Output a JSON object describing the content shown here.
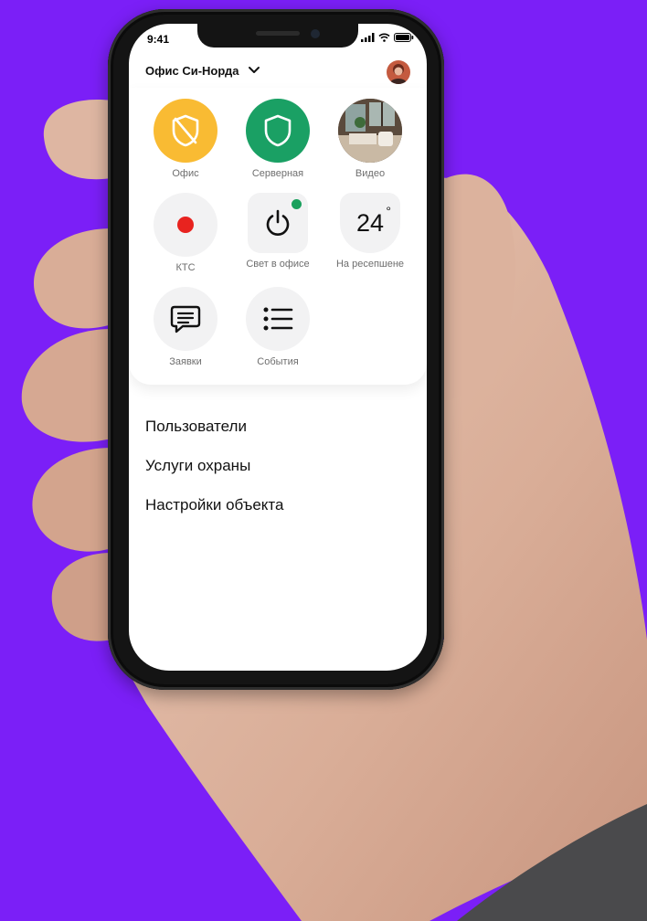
{
  "status_bar": {
    "time": "9:41"
  },
  "header": {
    "object_name": "Офис Си-Норда"
  },
  "tiles": [
    {
      "label": "Офис",
      "color": "#f9bb33",
      "icon": "shield-off-icon"
    },
    {
      "label": "Серверная",
      "color": "#1aa064",
      "icon": "shield-icon"
    },
    {
      "label": "Видео",
      "icon": "video-thumbnail"
    },
    {
      "label": "КТС",
      "icon": "record-dot-icon",
      "color": "#e8231f"
    },
    {
      "label": "Свет в офисе",
      "icon": "power-icon",
      "indicator": "#19a05c"
    },
    {
      "label": "На ресепшене",
      "temperature": "24",
      "unit": "°"
    },
    {
      "label": "Заявки",
      "icon": "chat-icon"
    },
    {
      "label": "События",
      "icon": "list-icon"
    }
  ],
  "menu": [
    {
      "label": "Пользователи"
    },
    {
      "label": "Услуги охраны"
    },
    {
      "label": "Настройки объекта"
    }
  ],
  "colors": {
    "background": "#7b1ff7",
    "accent_yellow": "#f9bb33",
    "accent_green": "#1aa064"
  }
}
